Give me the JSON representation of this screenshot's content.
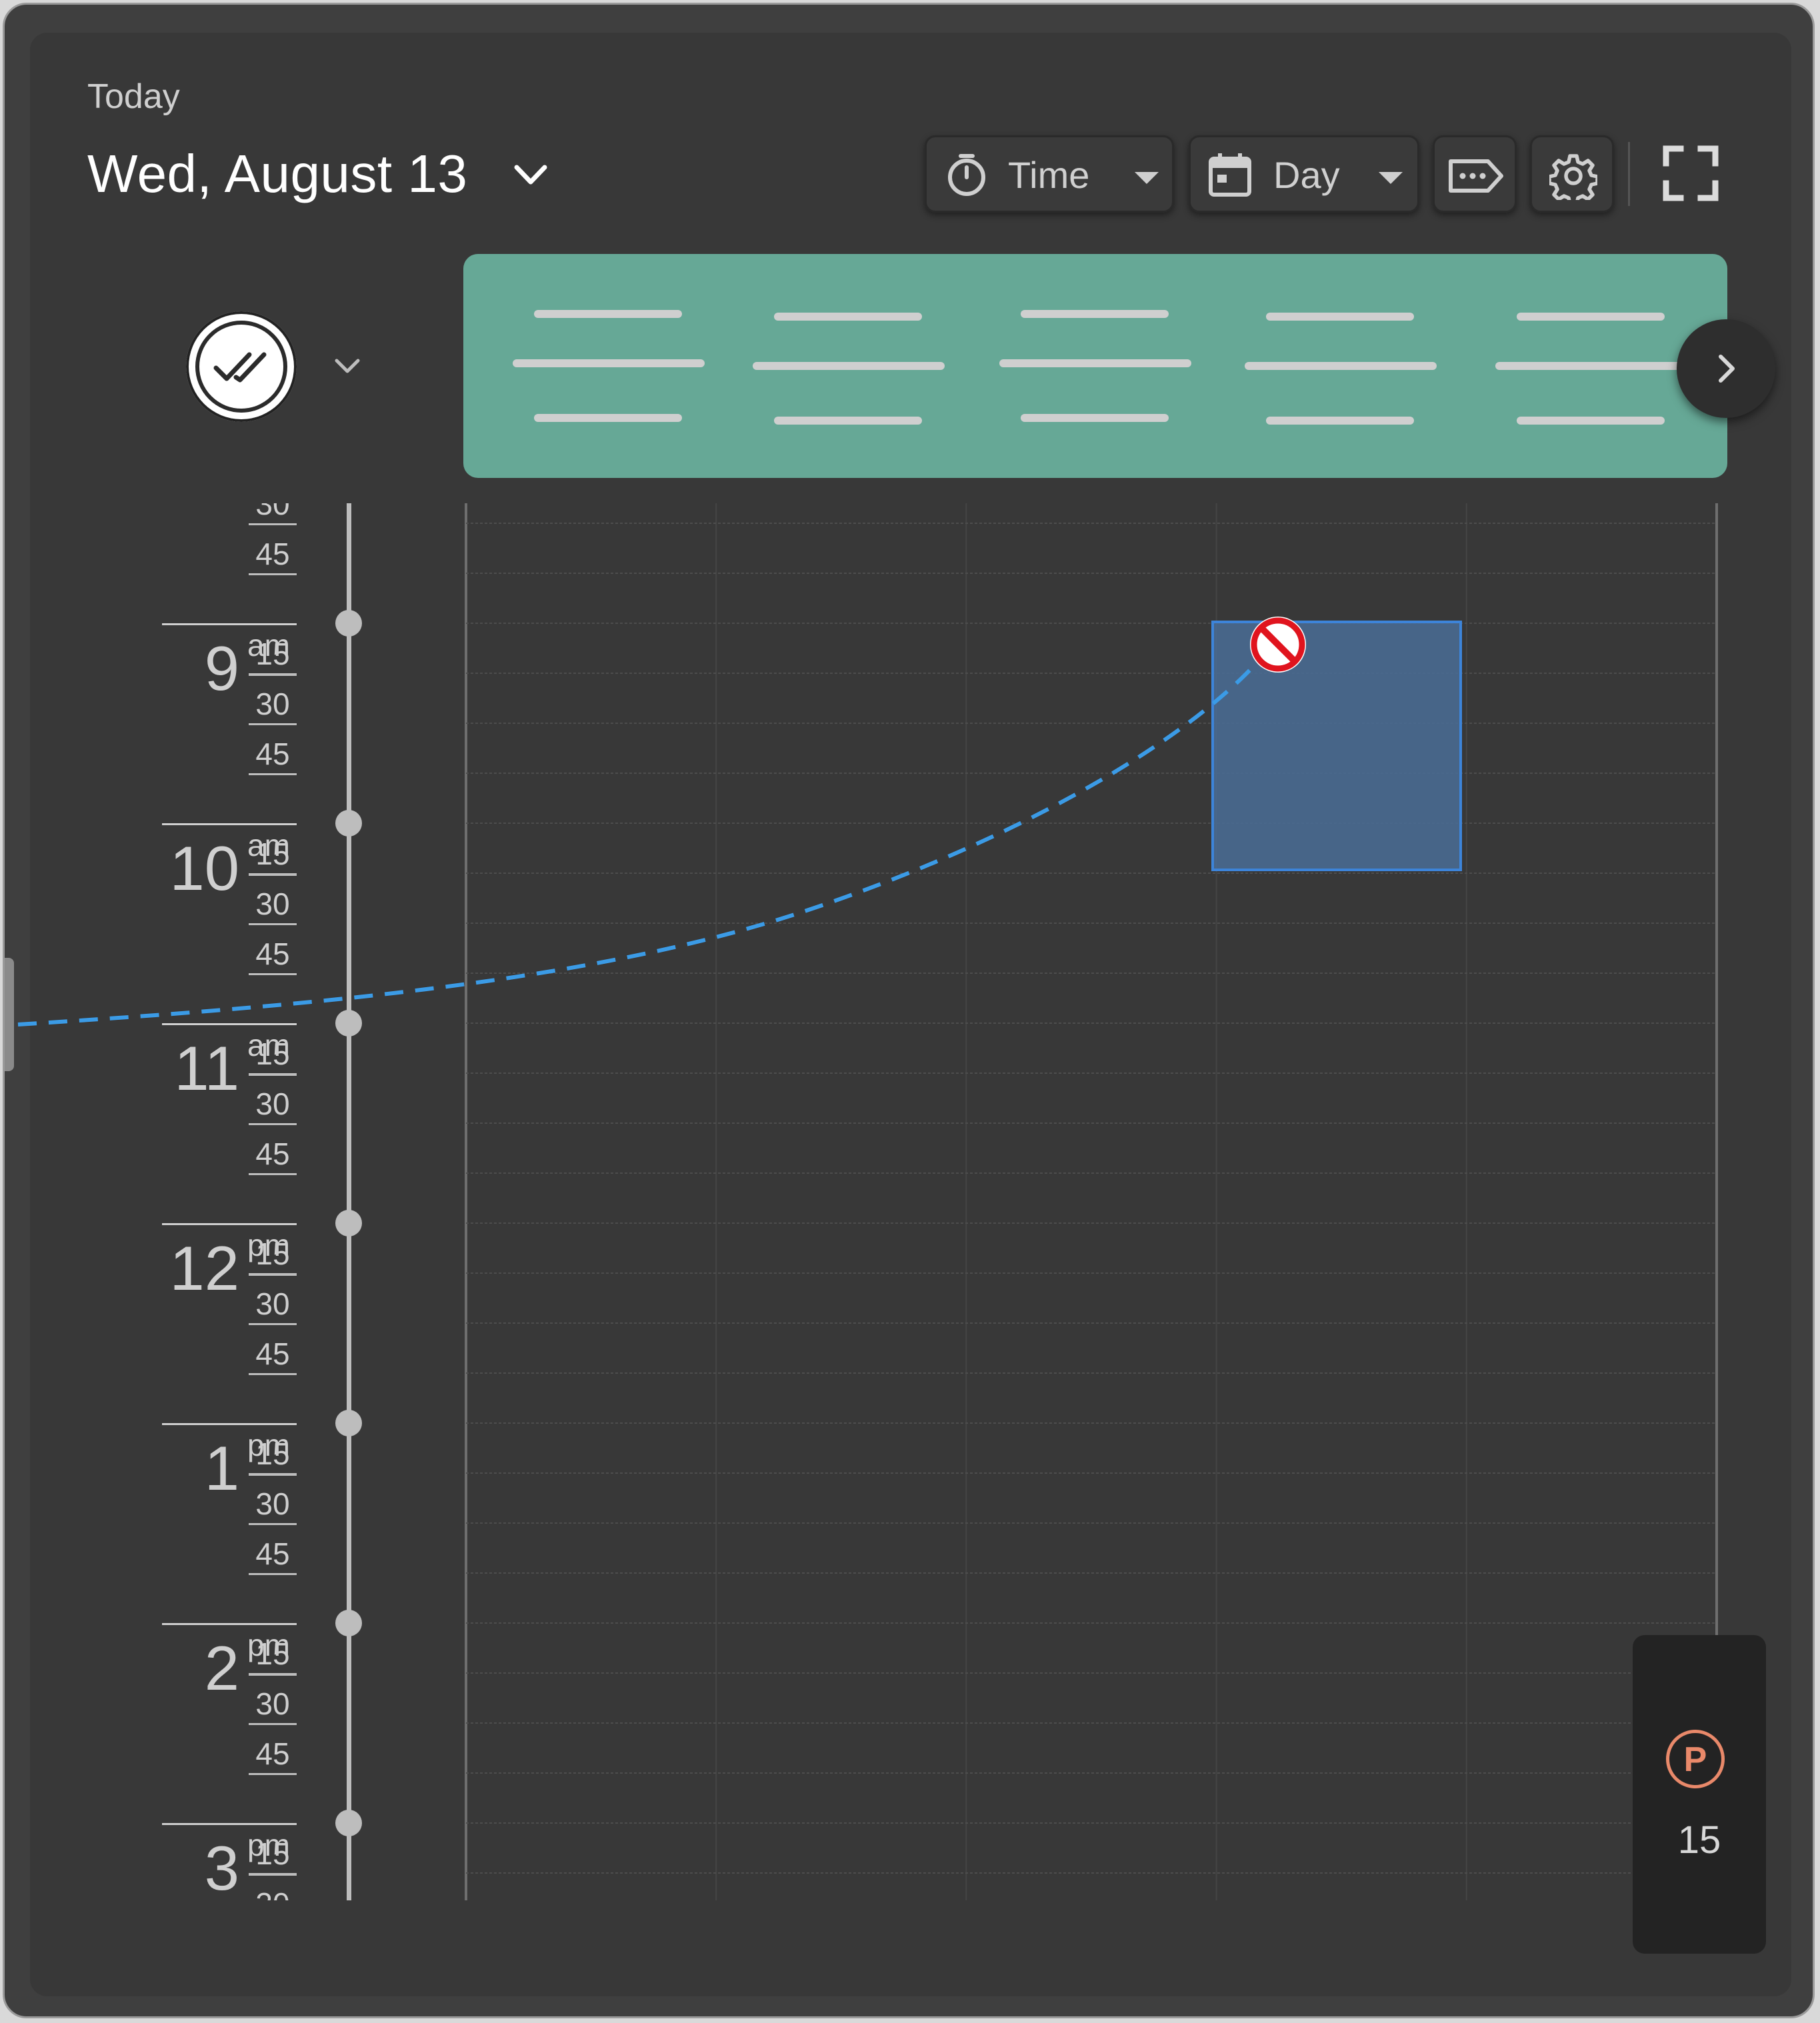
{
  "header": {
    "today_label": "Today",
    "date_title": "Wed, August 13"
  },
  "toolbar": {
    "time_label": "Time",
    "day_label": "Day",
    "icons": [
      "timer-icon",
      "calendar-icon",
      "label-tag-icon",
      "gear-icon",
      "fullscreen-icon"
    ]
  },
  "timeline": {
    "hours": [
      {
        "num": "9",
        "suffix": "am"
      },
      {
        "num": "10",
        "suffix": "am"
      },
      {
        "num": "11",
        "suffix": "am"
      },
      {
        "num": "12",
        "suffix": "pm"
      },
      {
        "num": "1",
        "suffix": "pm"
      },
      {
        "num": "2",
        "suffix": "pm"
      },
      {
        "num": "3",
        "suffix": "pm"
      }
    ],
    "minutes": [
      "15",
      "30",
      "45"
    ]
  },
  "parking": {
    "letter": "P",
    "count": "15"
  },
  "colors": {
    "accent_green": "#66a896",
    "selection_blue": "#3d84d9",
    "drag_path": "#3b9be6",
    "no_drop": "#e0141e",
    "parking_orange": "#e9896a"
  }
}
